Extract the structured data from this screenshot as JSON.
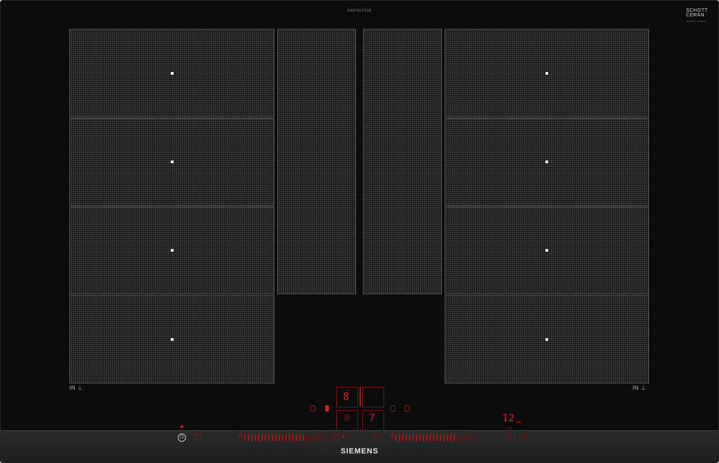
{
  "header": {
    "model_code": "EX875LYC1E",
    "maker_logo_line1": "SCHOTT",
    "maker_logo_line2": "CERAN",
    "maker_logo_sub": "SCHOTT CERAN"
  },
  "zones": {
    "left": [
      "left-zone-1",
      "left-zone-2",
      "left-zone-3",
      "left-zone-4"
    ],
    "center": [
      "center-zone-left",
      "center-zone-right"
    ],
    "right": [
      "right-zone-1",
      "right-zone-2",
      "right-zone-3",
      "right-zone-4"
    ]
  },
  "labels": {
    "left_in": "IN",
    "right_in": "IN",
    "pan_glyph": "⊥"
  },
  "controls": {
    "power_glyph": "⏻",
    "power_level_display": "8",
    "secondary_display": "7",
    "left_zone_display": "0",
    "timer_display": "12",
    "timer_unit": "min",
    "slider_left_start": "0",
    "slider_left_end": "9",
    "slider_right_start": "0",
    "slider_right_end": "9",
    "center_small_label": "3 ▲",
    "timer_small_label": "3 ▲"
  },
  "brand": "SIEMENS",
  "colors": {
    "glass": "#0b0b0b",
    "zone_grid": "#3c3c3c",
    "indicator_red": "#e02020",
    "zone_marker": "#f2f2f2"
  }
}
